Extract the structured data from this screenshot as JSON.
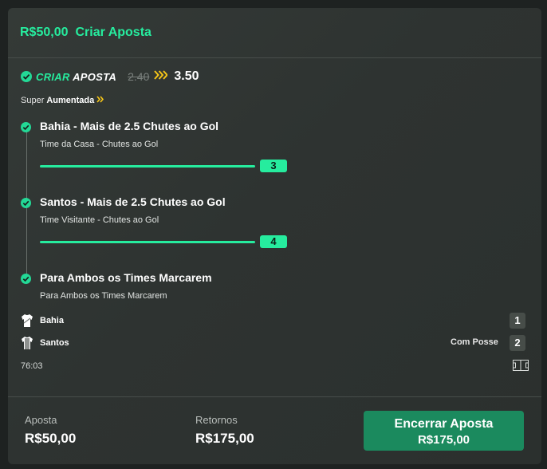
{
  "header": {
    "amount": "R$50,00",
    "title": "Criar Aposta"
  },
  "bet_builder": {
    "label_green": "CRIAR",
    "label_white": "APOSTA",
    "old_odds": "2.40",
    "new_odds": "3.50"
  },
  "boost": {
    "prefix": "Super",
    "label": "Aumentada"
  },
  "selections": [
    {
      "title": "Bahia - Mais de 2.5 Chutes ao Gol",
      "subtitle": "Time da Casa - Chutes ao Gol",
      "slider_value": "3"
    },
    {
      "title": "Santos - Mais de 2.5 Chutes ao Gol",
      "subtitle": "Time Visitante - Chutes ao Gol",
      "slider_value": "4"
    },
    {
      "title": "Para Ambos os Times Marcarem",
      "subtitle": "Para Ambos os Times Marcarem"
    }
  ],
  "match": {
    "home": {
      "name": "Bahia",
      "score": "1"
    },
    "away": {
      "name": "Santos",
      "score": "2",
      "status": "Com Posse"
    },
    "clock": "76:03"
  },
  "footer": {
    "stake_label": "Aposta",
    "stake_value": "R$50,00",
    "returns_label": "Retornos",
    "returns_value": "R$175,00",
    "cashout_label": "Encerrar Aposta",
    "cashout_value": "R$175,00"
  },
  "colors": {
    "accent": "#26ec9e",
    "boost": "#f5c518",
    "cashout": "#1b8a5e"
  },
  "icons": [
    "check-circle-icon",
    "boost-chevrons-icon",
    "jersey-icon",
    "pitch-icon"
  ]
}
